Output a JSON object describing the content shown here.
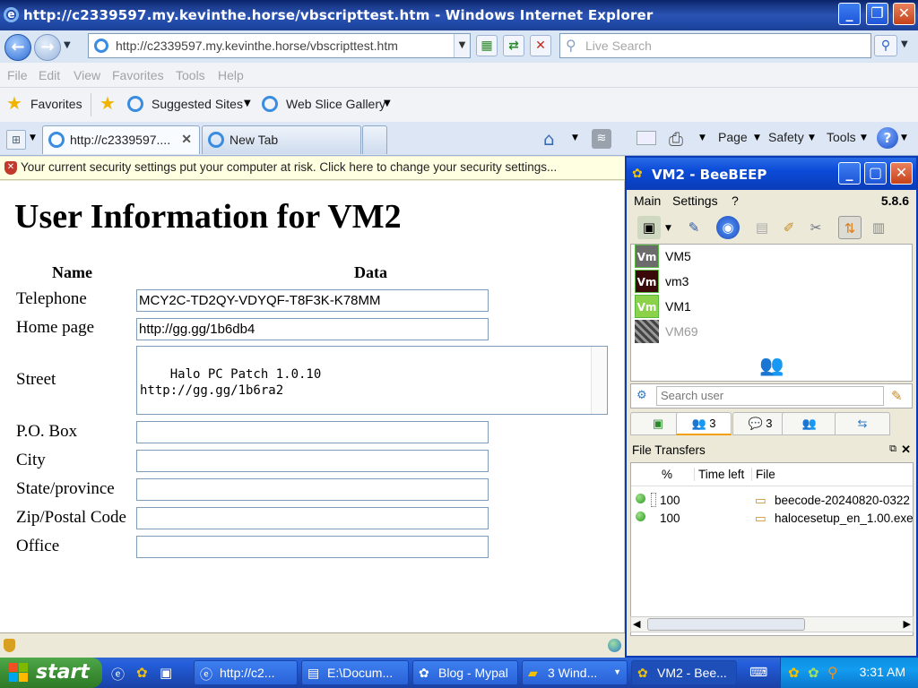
{
  "ie": {
    "title": "http://c2339597.my.kevinthe.horse/vbscripttest.htm - Windows Internet Explorer",
    "address": "http://c2339597.my.kevinthe.horse/vbscripttest.htm",
    "search_placeholder": "Live Search",
    "menu": [
      "File",
      "Edit",
      "View",
      "Favorites",
      "Tools",
      "Help"
    ],
    "favorites_label": "Favorites",
    "suggested_sites": "Suggested Sites",
    "web_slice_gallery": "Web Slice Gallery",
    "tabs": [
      {
        "label": "http://c2339597...."
      },
      {
        "label": "New Tab"
      }
    ],
    "commands": {
      "page": "Page",
      "safety": "Safety",
      "tools": "Tools"
    },
    "security_message": "Your current security settings put your computer at risk. Click here to change your security settings..."
  },
  "page": {
    "heading": "User Information for VM2",
    "col_name": "Name",
    "col_data": "Data",
    "fields": {
      "telephone": {
        "label": "Telephone",
        "value": "MCY2C-TD2QY-VDYQF-T8F3K-K78MM"
      },
      "home_page": {
        "label": "Home page",
        "value": "http://gg.gg/1b6db4"
      },
      "street": {
        "label": "Street",
        "value": "Halo PC Patch 1.0.10\nhttp://gg.gg/1b6ra2"
      },
      "po_box": {
        "label": "P.O. Box",
        "value": ""
      },
      "city": {
        "label": "City",
        "value": ""
      },
      "state": {
        "label": "State/province",
        "value": ""
      },
      "zip": {
        "label": "Zip/Postal Code",
        "value": ""
      },
      "office": {
        "label": "Office",
        "value": ""
      }
    }
  },
  "beebeep": {
    "title": "VM2 - BeeBEEP",
    "menu": [
      "Main",
      "Settings",
      "?"
    ],
    "version": "5.8.6",
    "users": [
      {
        "name": "VM5",
        "avatar": "Vm",
        "color": "#6c6c6c",
        "online": true
      },
      {
        "name": "vm3",
        "avatar": "Vm",
        "color": "#3a0a0a",
        "online": true
      },
      {
        "name": "VM1",
        "avatar": "Vm",
        "color": "#8bd14a",
        "online": true
      },
      {
        "name": "VM69",
        "avatar": "",
        "color": "#555555",
        "online": false
      }
    ],
    "search_placeholder": "Search user",
    "tab_counts": {
      "users": "3",
      "chats": "3"
    },
    "file_transfers_title": "File Transfers",
    "ft_columns": {
      "percent": "%",
      "time_left": "Time left",
      "file": "File"
    },
    "transfers": [
      {
        "percent": "100",
        "file": "beecode-20240820-0322"
      },
      {
        "percent": "100",
        "file": "halocesetup_en_1.00.exe"
      }
    ]
  },
  "taskbar": {
    "start": "start",
    "buttons": [
      {
        "label": "http://c2..."
      },
      {
        "label": "E:\\Docum..."
      },
      {
        "label": "Blog - Mypal"
      },
      {
        "label": "3 Wind..."
      },
      {
        "label": "VM2 - Bee..."
      }
    ],
    "clock": "3:31 AM"
  }
}
